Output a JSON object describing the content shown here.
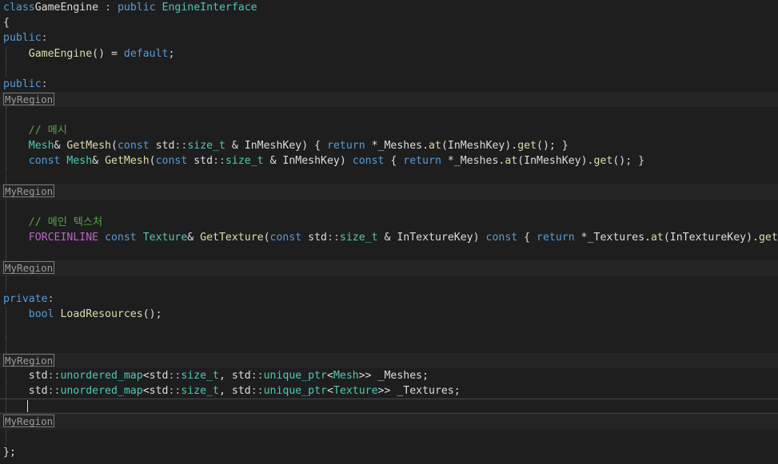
{
  "editor": {
    "colors": {
      "background": "#1e1e1e",
      "keyword": "#569cd6",
      "type": "#4ec9b0",
      "function": "#dcdcaa",
      "comment": "#57a64a",
      "macro": "#bd63c5",
      "default": "#dcdcdc"
    },
    "lines": [
      {
        "tokens": [
          [
            "kw",
            "class"
          ],
          [
            "",
            "GameEngine"
          ],
          [
            "punc",
            " : "
          ],
          [
            "kw",
            "public"
          ],
          [
            "ty",
            " EngineInterface"
          ]
        ]
      },
      {
        "tokens": [
          [
            "",
            "{"
          ]
        ]
      },
      {
        "tokens": [
          [
            "kw",
            "public"
          ],
          [
            "punc",
            ":"
          ]
        ]
      },
      {
        "tokens": [
          [
            "",
            "    "
          ],
          [
            "fn",
            "GameEngine"
          ],
          [
            "",
            "() = "
          ],
          [
            "kw",
            "default"
          ],
          [
            "",
            ";"
          ]
        ]
      },
      {
        "tokens": []
      },
      {
        "tokens": [
          [
            "kw",
            "public"
          ],
          [
            "punc",
            ":"
          ]
        ]
      },
      {
        "region": "MyRegion"
      },
      {
        "tokens": []
      },
      {
        "tokens": [
          [
            "",
            "    "
          ],
          [
            "cm",
            "// 메시"
          ]
        ]
      },
      {
        "tokens": [
          [
            "",
            "    "
          ],
          [
            "ty",
            "Mesh"
          ],
          [
            "",
            "& "
          ],
          [
            "fn",
            "GetMesh"
          ],
          [
            "",
            "("
          ],
          [
            "kw",
            "const"
          ],
          [
            "",
            " std"
          ],
          [
            "punc",
            "::"
          ],
          [
            "ty",
            "size_t"
          ],
          [
            "",
            " & InMeshKey) { "
          ],
          [
            "kw",
            "return"
          ],
          [
            "",
            " *_Meshes."
          ],
          [
            "fn",
            "at"
          ],
          [
            "",
            "(InMeshKey)."
          ],
          [
            "fn",
            "get"
          ],
          [
            "",
            "(); }"
          ]
        ]
      },
      {
        "tokens": [
          [
            "",
            "    "
          ],
          [
            "kw",
            "const"
          ],
          [
            "ty",
            " Mesh"
          ],
          [
            "",
            "& "
          ],
          [
            "fn",
            "GetMesh"
          ],
          [
            "",
            "("
          ],
          [
            "kw",
            "const"
          ],
          [
            "",
            " std"
          ],
          [
            "punc",
            "::"
          ],
          [
            "ty",
            "size_t"
          ],
          [
            "",
            " & InMeshKey) "
          ],
          [
            "kw",
            "const"
          ],
          [
            "",
            " { "
          ],
          [
            "kw",
            "return"
          ],
          [
            "",
            " *_Meshes."
          ],
          [
            "fn",
            "at"
          ],
          [
            "",
            "(InMeshKey)."
          ],
          [
            "fn",
            "get"
          ],
          [
            "",
            "(); }"
          ]
        ]
      },
      {
        "tokens": []
      },
      {
        "region": "MyRegion"
      },
      {
        "tokens": []
      },
      {
        "tokens": [
          [
            "",
            "    "
          ],
          [
            "cm",
            "// 메인 텍스처"
          ]
        ]
      },
      {
        "tokens": [
          [
            "",
            "    "
          ],
          [
            "mac",
            "FORCEINLINE"
          ],
          [
            "",
            ""
          ],
          [
            "kw",
            " const"
          ],
          [
            "ty",
            " Texture"
          ],
          [
            "",
            "& "
          ],
          [
            "fn",
            "GetTexture"
          ],
          [
            "",
            "("
          ],
          [
            "kw",
            "const"
          ],
          [
            "",
            " std"
          ],
          [
            "punc",
            "::"
          ],
          [
            "ty",
            "size_t"
          ],
          [
            "",
            " & InTextureKey) "
          ],
          [
            "kw",
            "const"
          ],
          [
            "",
            " { "
          ],
          [
            "kw",
            "return"
          ],
          [
            "",
            " *_Textures."
          ],
          [
            "fn",
            "at"
          ],
          [
            "",
            "(InTextureKey)."
          ],
          [
            "fn",
            "get"
          ],
          [
            "",
            "(); }"
          ]
        ]
      },
      {
        "tokens": []
      },
      {
        "region": "MyRegion"
      },
      {
        "tokens": []
      },
      {
        "tokens": [
          [
            "kw",
            "private"
          ],
          [
            "punc",
            ":"
          ]
        ]
      },
      {
        "tokens": [
          [
            "",
            "    "
          ],
          [
            "kw",
            "bool"
          ],
          [
            "fn",
            " LoadResources"
          ],
          [
            "",
            "();"
          ]
        ]
      },
      {
        "tokens": []
      },
      {
        "tokens": []
      },
      {
        "region": "MyRegion"
      },
      {
        "tokens": [
          [
            "",
            "    std"
          ],
          [
            "punc",
            "::"
          ],
          [
            "ty",
            "unordered_map"
          ],
          [
            "",
            "<std"
          ],
          [
            "punc",
            "::"
          ],
          [
            "ty",
            "size_t"
          ],
          [
            "",
            ", std"
          ],
          [
            "punc",
            "::"
          ],
          [
            "ty",
            "unique_ptr"
          ],
          [
            "",
            "<"
          ],
          [
            "ty",
            "Mesh"
          ],
          [
            "",
            ">> _Meshes;"
          ]
        ]
      },
      {
        "tokens": [
          [
            "",
            "    std"
          ],
          [
            "punc",
            "::"
          ],
          [
            "ty",
            "unordered_map"
          ],
          [
            "",
            "<std"
          ],
          [
            "punc",
            "::"
          ],
          [
            "ty",
            "size_t"
          ],
          [
            "",
            ", std"
          ],
          [
            "punc",
            "::"
          ],
          [
            "ty",
            "unique_ptr"
          ],
          [
            "",
            "<"
          ],
          [
            "ty",
            "Texture"
          ],
          [
            "",
            ">> _Textures;"
          ]
        ]
      },
      {
        "tokens": [],
        "current": true
      },
      {
        "region": "MyRegion"
      },
      {
        "tokens": []
      },
      {
        "tokens": [
          [
            "",
            "};"
          ]
        ]
      }
    ]
  }
}
